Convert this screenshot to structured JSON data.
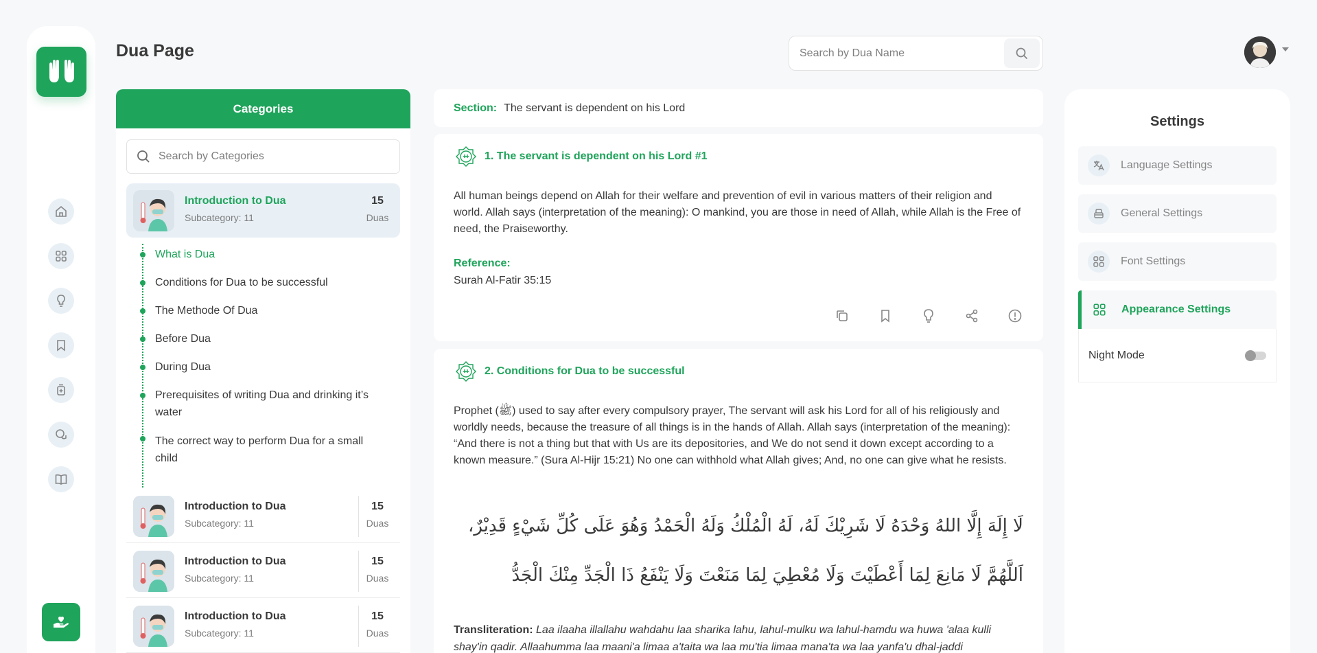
{
  "header": {
    "title": "Dua Page",
    "search_placeholder": "Search by Dua Name"
  },
  "rail": {
    "nav_icons": [
      "home-icon",
      "grid-icon",
      "bulb-icon",
      "bookmark-icon",
      "plus-jar-icon",
      "chat-icon",
      "book-icon"
    ],
    "logo_icon": "hands-icon",
    "donate_icon": "donate-icon"
  },
  "categories": {
    "title": "Categories",
    "search_placeholder": "Search by Categories",
    "active": {
      "name": "Introduction to Dua",
      "sub": "Subcategory: 11",
      "count": "15",
      "count_label": "Duas"
    },
    "subitems": [
      "What is Dua",
      "Conditions for Dua to be successful",
      "The Methode Of Dua",
      "Before Dua",
      "During Dua",
      "Prerequisites of writing Dua and drinking it’s water",
      "The correct way to perform Dua for a small child"
    ],
    "items": [
      {
        "name": "Introduction to Dua",
        "sub": "Subcategory: 11",
        "count": "15",
        "count_label": "Duas"
      },
      {
        "name": "Introduction to Dua",
        "sub": "Subcategory: 11",
        "count": "15",
        "count_label": "Duas"
      },
      {
        "name": "Introduction to Dua",
        "sub": "Subcategory: 11",
        "count": "15",
        "count_label": "Duas"
      }
    ]
  },
  "section": {
    "label": "Section:",
    "value": "The servant is dependent on his Lord"
  },
  "duas": [
    {
      "title": "1. The servant is dependent on his Lord #1",
      "body": "All human beings depend on Allah for their welfare and prevention of evil in various matters of their religion and world. Allah says (interpretation of the meaning): O mankind, you are those in need of Allah, while Allah is the Free of need, the Praiseworthy.",
      "reference_label": "Reference:",
      "reference": "Surah Al-Fatir 35:15"
    },
    {
      "title": "2. Conditions for Dua to be successful",
      "body": "Prophet (ﷺ) used to say after every compulsory prayer, The servant will ask his Lord for all of his religiously and worldly needs, because the treasure of all things is in the hands of Allah. Allah says (interpretation of the meaning): “And there is not a thing but that with Us are its depositories, and We do not send it down except according to a known measure.” (Sura Al-Hijr 15:21) No one can withhold what Allah gives; And, no one can give what he resists.",
      "arabic": "لَا إِلَهَ إِلَّا اللهُ وَحْدَهُ لَا شَرِيْكَ لَهُ، لَهُ الْمُلْكُ وَلَهُ الْحَمْدُ وَهُوَ عَلَى كُلِّ شَيْءٍ قَدِيْرٌ، اَللَّهُمَّ لَا مَانِعَ لِمَا أَعْطَيْتَ وَلَا مُعْطِيَ لِمَا مَنَعْتَ وَلَا يَنْفَعُ ذَا الْجَدِّ مِنْكَ الْجَدُّ",
      "translit_label": "Transliteration:",
      "translit": "Laa ilaaha illallahu wahdahu laa sharika lahu, lahul-mulku wa lahul-hamdu wa huwa 'alaa kulli shay'in qadir. Allaahumma laa maani'a limaa a'taita wa laa mu'tia limaa mana'ta wa laa yanfa'u dhal-jaddi"
    }
  ],
  "actions": [
    "copy-icon",
    "bookmark-icon",
    "bulb-icon",
    "share-icon",
    "report-icon"
  ],
  "settings": {
    "title": "Settings",
    "items": [
      {
        "label": "Language Settings",
        "icon": "translate-icon"
      },
      {
        "label": "General Settings",
        "icon": "general-icon"
      },
      {
        "label": "Font Settings",
        "icon": "grid-icon"
      },
      {
        "label": "Appearance Settings",
        "icon": "grid-icon"
      }
    ],
    "night_mode_label": "Night Mode",
    "night_mode": false
  },
  "colors": {
    "accent": "#1fa45b",
    "text": "#393939",
    "muted": "#868686"
  }
}
